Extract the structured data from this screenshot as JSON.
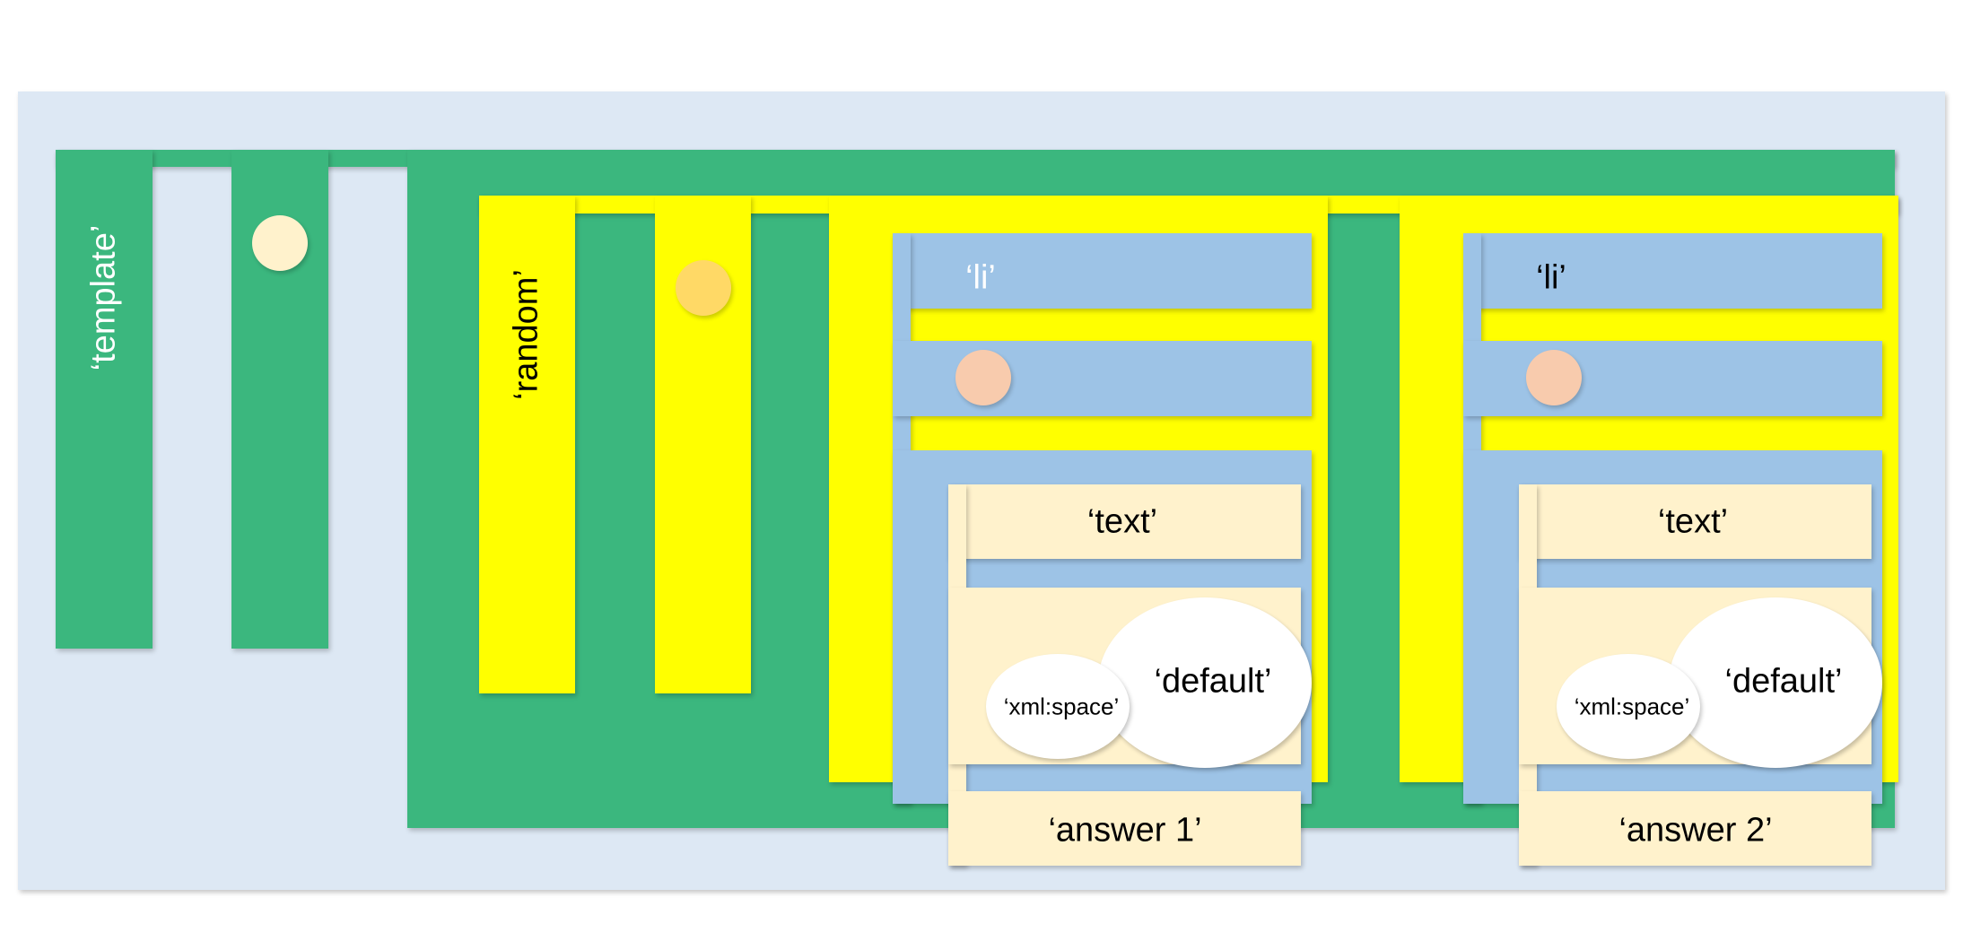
{
  "diagram": {
    "template_label": "‘template’",
    "random_label": "‘random’",
    "branches": [
      {
        "li_label": "‘li’",
        "text_label": "‘text’",
        "attr_key": "‘xml:space’",
        "attr_value": "‘default’",
        "content": "‘answer 1’"
      },
      {
        "li_label": "‘li’",
        "text_label": "‘text’",
        "attr_key": "‘xml:space’",
        "attr_value": "‘default’",
        "content": "‘answer 2’"
      }
    ]
  },
  "colors": {
    "background_panel": "#dde8f4",
    "template": "#3bb77e",
    "random": "#ffff00",
    "li": "#9dc3e6",
    "text": "#fff2cc",
    "attribute": "#ffffff",
    "template_dot": "#fff2cc",
    "random_dot": "#ffd966",
    "li_dot": "#f8cbad"
  }
}
